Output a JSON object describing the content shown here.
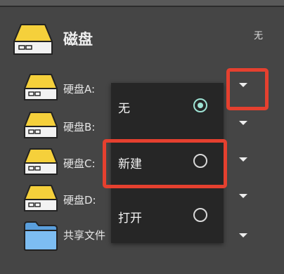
{
  "header": {
    "title": "磁盘",
    "status": "无"
  },
  "rows": [
    {
      "label": "硬盘A:",
      "icon": "hard-drive-icon"
    },
    {
      "label": "硬盘B:",
      "icon": "hard-drive-icon"
    },
    {
      "label": "硬盘C:",
      "icon": "hard-drive-icon"
    },
    {
      "label": "硬盘D:",
      "icon": "hard-drive-icon"
    },
    {
      "label": "共享文件",
      "icon": "folder-icon"
    }
  ],
  "popup": {
    "options": [
      {
        "label": "无",
        "selected": true
      },
      {
        "label": "新建",
        "selected": false
      },
      {
        "label": "打开",
        "selected": false
      }
    ]
  },
  "colors": {
    "background": "#454545",
    "drive_yellow": "#f5d03b",
    "folder_blue": "#6fb2ec",
    "radio_selected": "#9ee3d4",
    "highlight": "#e5402f"
  }
}
